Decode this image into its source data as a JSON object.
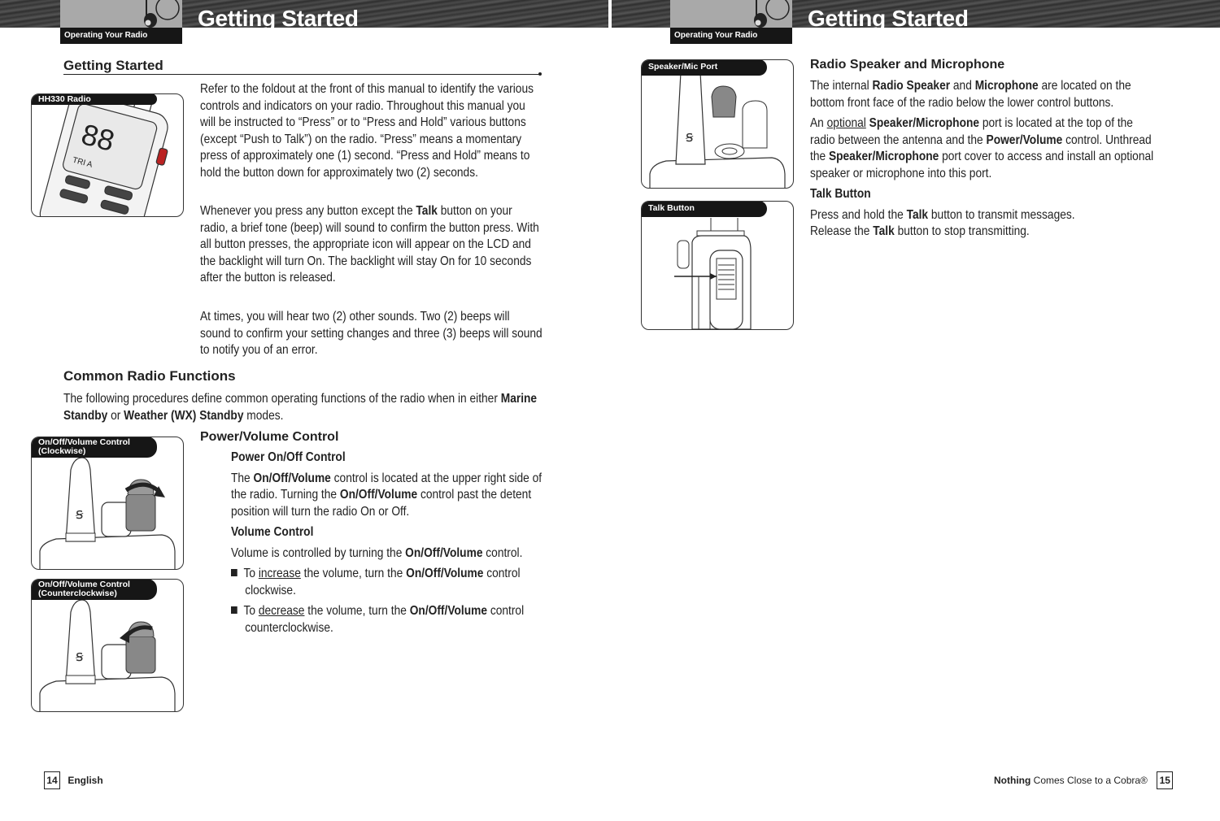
{
  "header": {
    "left": {
      "section_tab": "Operating Your Radio",
      "title": "Getting Started"
    },
    "right": {
      "section_tab": "Operating Your Radio",
      "title": "Getting Started"
    }
  },
  "left_page": {
    "heading": "Getting Started",
    "figure_hh330": {
      "label": "HH330 Radio"
    },
    "intro_paragraphs": [
      "Refer to the foldout at the front of this manual to identify the various controls and indicators on your radio. Throughout this manual you will be instructed to “Press” or to “Press and Hold” various buttons (except “Push to Talk”) on the radio. “Press” means a momentary press of approximately one (1) second. “Press and Hold” means to hold the button down for approximately two (2) seconds."
    ],
    "beep_paragraph": {
      "pre": "Whenever you press any button except the ",
      "bold": "Talk",
      "post": " button on your radio, a brief tone (beep) will sound to confirm the button press. With all button presses, the appropriate icon will appear on the LCD and the backlight will turn On. The backlight will stay On for 10 seconds after the button is released."
    },
    "sounds_paragraph": "At times, you will hear two (2) other sounds. Two (2) beeps will sound to confirm your setting changes and three (3) beeps will sound to notify you of an error.",
    "common_functions": {
      "heading": "Common Radio Functions",
      "text_pre": "The following procedures define common operating functions of the radio when in either ",
      "bold1": "Marine Standby",
      "text_mid": " or ",
      "bold2": "Weather (WX) Standby",
      "text_post": " modes."
    },
    "figure_clockwise": {
      "label_line1": "On/Off/Volume Control",
      "label_line2": "(Clockwise)"
    },
    "figure_counterclockwise": {
      "label_line1": "On/Off/Volume Control",
      "label_line2": "(Counterclockwise)"
    },
    "power_volume": {
      "heading": "Power/Volume Control",
      "power_onoff_heading": "Power On/Off Control",
      "power_text": {
        "t1": "The ",
        "b1": "On/Off/Volume",
        "t2": " control is located at the upper right side of the radio. Turning the ",
        "b2": "On/Off/Volume",
        "t3": " control past the detent position will turn the radio On or Off."
      },
      "volume_heading": "Volume Control",
      "volume_text": {
        "t1": "Volume is controlled by turning the ",
        "b1": "On/Off/Volume",
        "t2": " control."
      },
      "bullets": [
        {
          "pre": "To ",
          "underline": "increase",
          "mid": " the volume, turn the ",
          "bold": "On/Off/Volume",
          "post": " control clockwise."
        },
        {
          "pre": "To ",
          "underline": "decrease",
          "mid": " the volume, turn the ",
          "bold": "On/Off/Volume",
          "post": " control counterclockwise."
        }
      ]
    },
    "footer": {
      "page_number": "14",
      "language": "English"
    }
  },
  "right_page": {
    "figure_speaker": {
      "label": "Speaker/Mic Port"
    },
    "figure_talk": {
      "label": "Talk Button"
    },
    "speaker_mic": {
      "heading": "Radio Speaker and Microphone",
      "p1": {
        "t1": "The internal ",
        "b1": "Radio Speaker",
        "t2": " and ",
        "b2": "Microphone",
        "t3": " are located on the bottom front face of the radio below the lower control buttons."
      },
      "p2": {
        "t1": "An ",
        "u1": "optional",
        "t2": " ",
        "b1": "Speaker/Microphone",
        "t3": " port is located at the top of the radio between the antenna and the ",
        "b2": "Power/Volume",
        "t4": " control. Unthread the ",
        "b3": "Speaker/Microphone",
        "t5": " port cover to access and install an optional speaker or microphone into this port."
      }
    },
    "talk_button": {
      "heading": "Talk Button",
      "line1": {
        "t1": "Press and hold the ",
        "b1": "Talk",
        "t2": " button to transmit messages."
      },
      "line2": {
        "t1": "Release the ",
        "b1": "Talk",
        "t2": " button to stop transmitting."
      }
    },
    "footer": {
      "slogan_bold": "Nothing",
      "slogan_rest": " Comes Close to a Cobra®",
      "page_number": "15"
    }
  }
}
